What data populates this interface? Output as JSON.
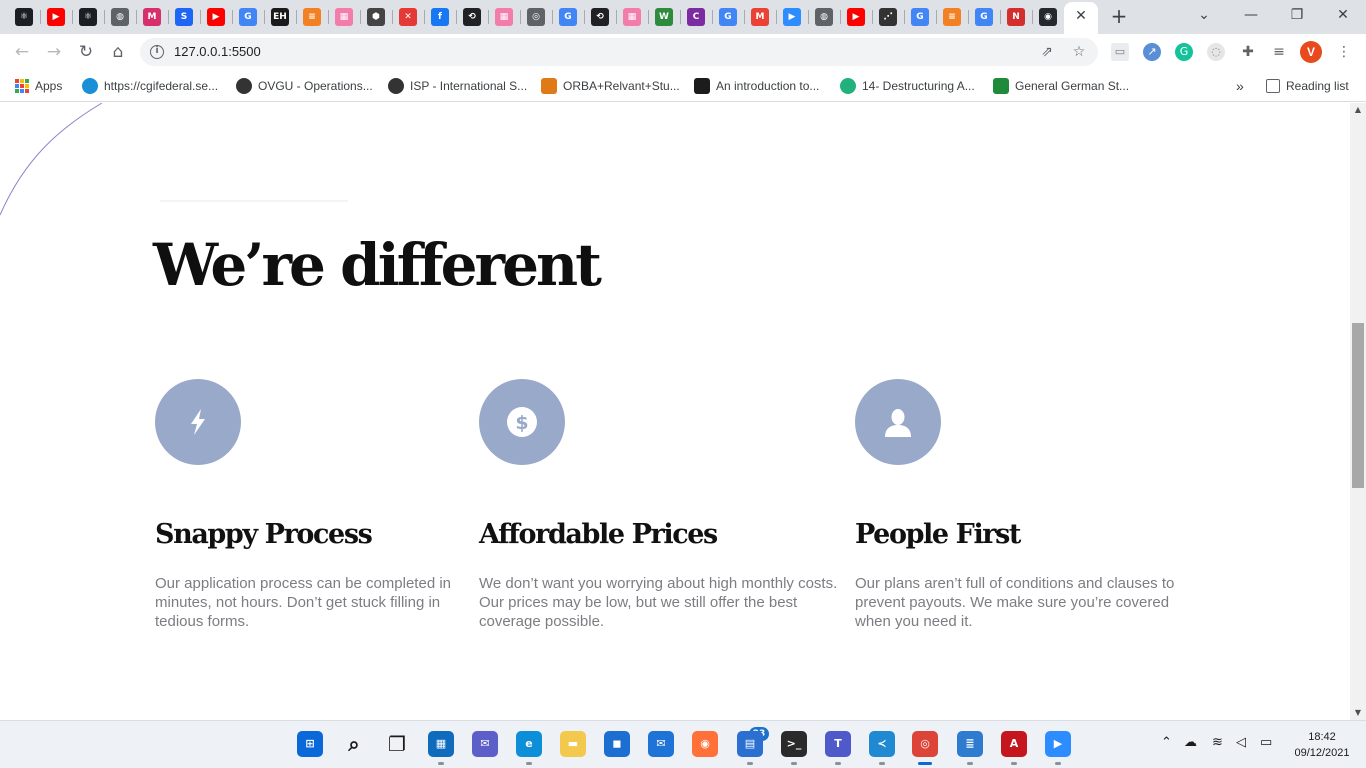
{
  "browser": {
    "tabs": [
      {
        "icon": "react-icon",
        "color": "#1b1f23",
        "glyph": "⚛"
      },
      {
        "icon": "youtube-icon",
        "color": "#ff0000",
        "glyph": "▶"
      },
      {
        "icon": "react-icon",
        "color": "#1b1f23",
        "glyph": "⚛"
      },
      {
        "icon": "globe-icon",
        "color": "#5f6368",
        "glyph": "◍"
      },
      {
        "icon": "miro-icon",
        "color": "#d72f6b",
        "glyph": "M"
      },
      {
        "icon": "s-icon",
        "color": "#1e66f5",
        "glyph": "S"
      },
      {
        "icon": "youtube-icon",
        "color": "#ff0000",
        "glyph": "▶"
      },
      {
        "icon": "google-icon",
        "color": "#4285f4",
        "glyph": "G"
      },
      {
        "icon": "eh-icon",
        "color": "#1a1a1a",
        "glyph": "EH"
      },
      {
        "icon": "stackoverflow-icon",
        "color": "#f48024",
        "glyph": "≡"
      },
      {
        "icon": "pink-doc-icon",
        "color": "#f27dab",
        "glyph": "▦"
      },
      {
        "icon": "box-icon",
        "color": "#444",
        "glyph": "⬢"
      },
      {
        "icon": "figure-icon",
        "color": "#e53935",
        "glyph": "✕"
      },
      {
        "icon": "facebook-icon",
        "color": "#1877f2",
        "glyph": "f"
      },
      {
        "icon": "link-icon",
        "color": "#202124",
        "glyph": "⟲"
      },
      {
        "icon": "pink-doc-icon",
        "color": "#f27dab",
        "glyph": "▦"
      },
      {
        "icon": "chrome-icon",
        "color": "#5f6368",
        "glyph": "◎"
      },
      {
        "icon": "google-icon",
        "color": "#4285f4",
        "glyph": "G"
      },
      {
        "icon": "link-icon",
        "color": "#202124",
        "glyph": "⟲"
      },
      {
        "icon": "pink-doc-icon",
        "color": "#f27dab",
        "glyph": "▦"
      },
      {
        "icon": "w-icon",
        "color": "#2e8b3e",
        "glyph": "W"
      },
      {
        "icon": "c-icon",
        "color": "#7b2ca0",
        "glyph": "C"
      },
      {
        "icon": "google-icon",
        "color": "#4285f4",
        "glyph": "G"
      },
      {
        "icon": "gmail-icon",
        "color": "#ea4335",
        "glyph": "M"
      },
      {
        "icon": "zoom-icon",
        "color": "#2d8cff",
        "glyph": "▶"
      },
      {
        "icon": "globe-icon",
        "color": "#5f6368",
        "glyph": "◍"
      },
      {
        "icon": "youtube-icon",
        "color": "#ff0000",
        "glyph": "▶"
      },
      {
        "icon": "dots-icon",
        "color": "#333",
        "glyph": "⋰"
      },
      {
        "icon": "google-icon",
        "color": "#4285f4",
        "glyph": "G"
      },
      {
        "icon": "stackoverflow-icon",
        "color": "#f48024",
        "glyph": "≡"
      },
      {
        "icon": "google-icon",
        "color": "#4285f4",
        "glyph": "G"
      },
      {
        "icon": "n-icon",
        "color": "#d32f2f",
        "glyph": "N"
      },
      {
        "icon": "github-icon",
        "color": "#24292e",
        "glyph": "◉"
      }
    ],
    "active_tab_close": "✕",
    "new_tab": "+",
    "window_controls": {
      "dropdown": "⌄",
      "minimize": "—",
      "restore": "❐",
      "close": "✕"
    },
    "url": "127.0.0.1:5500",
    "profile_initial": "V",
    "bookmarks": [
      {
        "label": "Apps",
        "icon": "apps-grid-icon",
        "color": "#4285f4"
      },
      {
        "label": "https://cgifederal.se...",
        "icon": "cloud-icon",
        "color": "#1a8fd6"
      },
      {
        "label": "OVGU - Operations...",
        "icon": "person-icon",
        "color": "#333333"
      },
      {
        "label": "ISP - International S...",
        "icon": "person-icon",
        "color": "#333333"
      },
      {
        "label": "ORBA+Relvant+Stu...",
        "icon": "folder-icon",
        "color": "#e07a16"
      },
      {
        "label": "An introduction to...",
        "icon": "a-icon",
        "color": "#1c1c1c"
      },
      {
        "label": "14- Destructuring A...",
        "icon": "t-icon",
        "color": "#20b27a"
      },
      {
        "label": "General German St...",
        "icon": "grid-icon",
        "color": "#1e8a3a"
      }
    ],
    "bookmarks_overflow": "»",
    "reading_list": "Reading list"
  },
  "page": {
    "heading": "We’re different",
    "features": [
      {
        "icon": "lightning-icon",
        "title": "Snappy Process",
        "description": "Our application process can be completed in minutes, not hours. Don’t get stuck filling in tedious forms."
      },
      {
        "icon": "dollar-icon",
        "title": "Affordable Prices",
        "description": "We don’t want you worrying about high monthly costs. Our prices may be low, but we still offer the best coverage possible."
      },
      {
        "icon": "person-icon",
        "title": "People First",
        "description": "Our plans aren’t full of conditions and clauses to prevent payouts. We make sure you’re covered when you need it."
      }
    ],
    "accent_color": "#98a9c9"
  },
  "taskbar": {
    "apps": [
      {
        "name": "start-icon",
        "color": "#0a68d8"
      },
      {
        "name": "search-icon",
        "color": "#1b1b1b"
      },
      {
        "name": "task-view-icon",
        "color": "#1b1b1b"
      },
      {
        "name": "widgets-icon",
        "color": "#0f6cbd"
      },
      {
        "name": "chat-icon",
        "color": "#5b5fc7"
      },
      {
        "name": "edge-icon",
        "color": "#0c8ed9"
      },
      {
        "name": "file-explorer-icon",
        "color": "#f2c94c"
      },
      {
        "name": "store-icon",
        "color": "#1c6fd0"
      },
      {
        "name": "mail-icon",
        "color": "#1e73d6"
      },
      {
        "name": "firefox-icon",
        "color": "#ff7139"
      },
      {
        "name": "tasks-icon",
        "color": "#2b6fd0"
      },
      {
        "name": "terminal-icon",
        "color": "#2a2a2a"
      },
      {
        "name": "teams-icon",
        "color": "#5059c9"
      },
      {
        "name": "vscode-icon",
        "color": "#1f8ad2"
      },
      {
        "name": "chrome-icon",
        "color": "#db4437"
      },
      {
        "name": "notepad-icon",
        "color": "#2e7bcf"
      },
      {
        "name": "acrobat-icon",
        "color": "#c4161c"
      },
      {
        "name": "zoom-icon",
        "color": "#2d8cff"
      }
    ],
    "notification_badge": "23",
    "time": "18:42",
    "date": "09/12/2021"
  }
}
